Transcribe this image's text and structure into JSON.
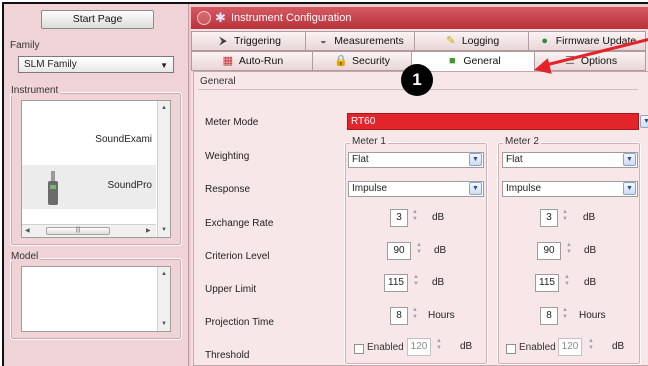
{
  "left": {
    "start_page": "Start Page",
    "family_label": "Family",
    "family_value": "SLM Family",
    "instrument_label": "Instrument",
    "instruments": [
      "SoundExami",
      "SoundPro"
    ],
    "model_label": "Model"
  },
  "dialog": {
    "title": "Instrument Configuration",
    "tabs_row1": [
      {
        "label": "Triggering",
        "icon": "trigger-icon"
      },
      {
        "label": "Measurements",
        "icon": "gauge-icon"
      },
      {
        "label": "Logging",
        "icon": "pencil-icon"
      },
      {
        "label": "Firmware Update",
        "icon": "globe-icon"
      }
    ],
    "tabs_row2": [
      {
        "label": "Auto-Run",
        "icon": "calendar-icon"
      },
      {
        "label": "Security",
        "icon": "lock-icon"
      },
      {
        "label": "General",
        "icon": "green-square-icon"
      },
      {
        "label": "Options",
        "icon": "options-icon"
      }
    ],
    "section": "General",
    "meter_mode_label": "Meter Mode",
    "meter_mode_value": "RT60",
    "meter1_label": "Meter 1",
    "meter2_label": "Meter 2",
    "rows": {
      "weighting": "Weighting",
      "response": "Response",
      "exchange_rate": "Exchange Rate",
      "criterion_level": "Criterion Level",
      "upper_limit": "Upper Limit",
      "projection_time": "Projection Time",
      "threshold": "Threshold"
    },
    "meter1": {
      "weighting": "Flat",
      "response": "Impulse",
      "exchange_rate": "3",
      "criterion_level": "90",
      "upper_limit": "115",
      "projection_time": "8",
      "threshold_enabled": "Enabled",
      "threshold": "120"
    },
    "meter2": {
      "weighting": "Flat",
      "response": "Impulse",
      "exchange_rate": "3",
      "criterion_level": "90",
      "upper_limit": "115",
      "projection_time": "8",
      "threshold_enabled": "Enabled",
      "threshold": "120"
    },
    "units": {
      "db": "dB",
      "hours": "Hours"
    }
  },
  "callout": {
    "number": "1",
    "color": "#e2232a"
  },
  "colors": {
    "accent": "#c0363f",
    "meter_mode_bg": "#e2242b"
  }
}
